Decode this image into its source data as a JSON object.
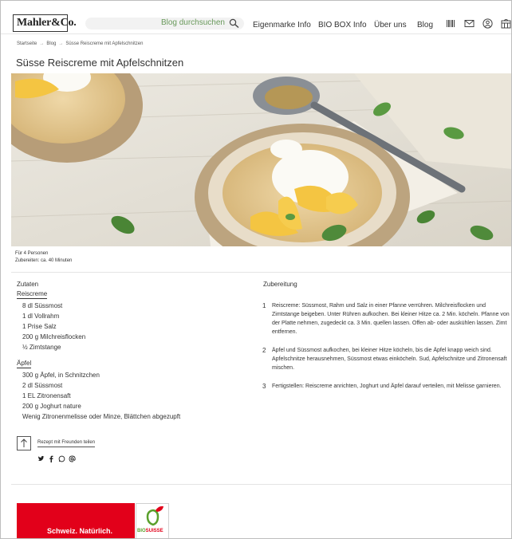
{
  "header": {
    "logo": "Mahler&Co.",
    "search_placeholder": "Blog durchsuchen",
    "nav": [
      "Eigenmarke Info",
      "BIO BOX Info",
      "Über uns",
      "Blog"
    ]
  },
  "breadcrumb": [
    "Startseite",
    "Blog",
    "Süsse Reiscreme mit Apfelschnitzen"
  ],
  "page_title": "Süsse Reiscreme mit Apfelschnitzen",
  "meta": {
    "servings": "Für 4 Personen",
    "prep": "Zubereiten: ca. 40 Minuten"
  },
  "ingredients": {
    "heading": "Zutaten",
    "groups": [
      {
        "title": "Reiscreme",
        "items": [
          "8 dl Süssmost",
          "1 dl Vollrahm",
          "1 Prise Salz",
          "200 g Milchreisflocken",
          "½ Zimtstange"
        ]
      },
      {
        "title": "Äpfel",
        "items": [
          "300 g Äpfel, in Schnitzchen",
          "2 dl Süssmost",
          "1 EL Zitronensaft",
          "200 g Joghurt nature",
          "Wenig Zitronenmelisse oder Minze, Blättchen abgezupft"
        ]
      }
    ]
  },
  "preparation": {
    "heading": "Zubereitung",
    "steps": [
      {
        "num": "1",
        "text": "Reiscreme: Süssmost, Rahm und Salz in einer Pfanne verrühren. Milchreisflocken und Zimtstange beigeben. Unter Rühren aufkochen. Bei kleiner Hitze ca. 2 Min. köcheln. Pfanne von der Platte nehmen, zugedeckt ca. 3 Min. quellen lassen. Offen ab- oder auskühlen lassen. Zimt entfernen."
      },
      {
        "num": "2",
        "text": "Äpfel und Süssmost aufkochen, bei kleiner Hitze köcheln, bis die Äpfel knapp weich sind. Apfelschnitze herausnehmen, Süssmost etwas einköcheln. Sud, Apfelschnitze und Zitronensaft mischen."
      },
      {
        "num": "3",
        "text": "Fertigstellen: Reiscreme anrichten, Joghurt und Äpfel darauf verteilen, mit Melisse garnieren."
      }
    ]
  },
  "share": {
    "label": "Rezept mit Freunden teilen",
    "icons": [
      "twitter-icon",
      "facebook-icon",
      "whatsapp-icon",
      "email-at-icon"
    ]
  },
  "footer": {
    "banner_text": "Schweiz. Natürlich.",
    "bio_bio": "BIO",
    "bio_suisse": "SUISSE"
  },
  "colors": {
    "accent_green": "#6a9a5c",
    "banner_red": "#e2001a",
    "bio_green": "#5aa02c"
  }
}
